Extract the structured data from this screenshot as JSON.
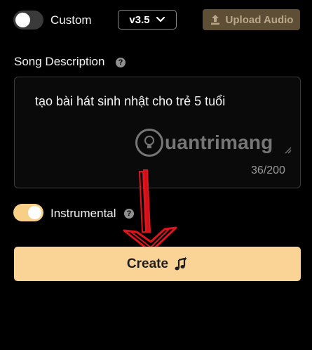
{
  "header": {
    "custom_label": "Custom",
    "custom_enabled": false,
    "version": "v3.5",
    "upload_label": "Upload Audio"
  },
  "description": {
    "label": "Song Description",
    "text": "tạo bài hát sinh nhật cho trẻ 5 tuổi",
    "char_count": "36/200"
  },
  "instrumental": {
    "label": "Instrumental",
    "enabled": true
  },
  "create": {
    "label": "Create"
  },
  "watermark": {
    "text": "uantrimang"
  },
  "colors": {
    "accent": "#fad396",
    "toggle_on": "#f8cf86",
    "upload_bg": "#5e4e35",
    "annotation_arrow": "#e0141c"
  },
  "icons": {
    "upload": "upload-icon",
    "version_dropdown": "chevron-down-icon",
    "help": "question-icon",
    "create": "music-sparkle-icon",
    "watermark": "lightbulb-icon"
  }
}
